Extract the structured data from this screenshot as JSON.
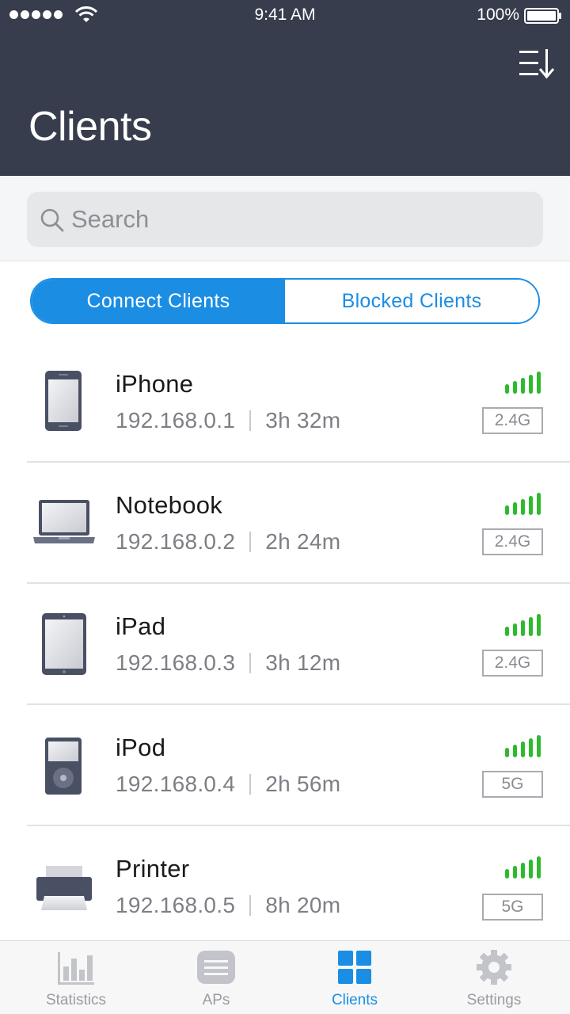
{
  "status_bar": {
    "time": "9:41 AM",
    "battery": "100%"
  },
  "header": {
    "title": "Clients",
    "sort_icon": "sort-descending-icon"
  },
  "search": {
    "placeholder": "Search",
    "value": ""
  },
  "segments": [
    {
      "label": "Connect Clients",
      "active": true
    },
    {
      "label": "Blocked Clients",
      "active": false
    }
  ],
  "clients": [
    {
      "name": "iPhone",
      "ip": "192.168.0.1",
      "duration": "3h 32m",
      "band": "2.4G",
      "device_icon": "phone-icon",
      "signal_level": 5
    },
    {
      "name": "Notebook",
      "ip": "192.168.0.2",
      "duration": "2h 24m",
      "band": "2.4G",
      "device_icon": "laptop-icon",
      "signal_level": 5
    },
    {
      "name": "iPad",
      "ip": "192.168.0.3",
      "duration": "3h 12m",
      "band": "2.4G",
      "device_icon": "tablet-icon",
      "signal_level": 5
    },
    {
      "name": "iPod",
      "ip": "192.168.0.4",
      "duration": "2h 56m",
      "band": "5G",
      "device_icon": "music-player-icon",
      "signal_level": 5
    },
    {
      "name": "Printer",
      "ip": "192.168.0.5",
      "duration": "8h 20m",
      "band": "5G",
      "device_icon": "printer-icon",
      "signal_level": 5
    }
  ],
  "tabs": [
    {
      "label": "Statistics",
      "icon": "bar-chart-icon",
      "active": false
    },
    {
      "label": "APs",
      "icon": "access-point-icon",
      "active": false
    },
    {
      "label": "Clients",
      "icon": "grid-icon",
      "active": true
    },
    {
      "label": "Settings",
      "icon": "gear-icon",
      "active": false
    }
  ],
  "colors": {
    "header_bg": "#373d4c",
    "accent": "#1b8ee3",
    "signal_green": "#2dbb2d",
    "icon_dark": "#4a5064"
  }
}
